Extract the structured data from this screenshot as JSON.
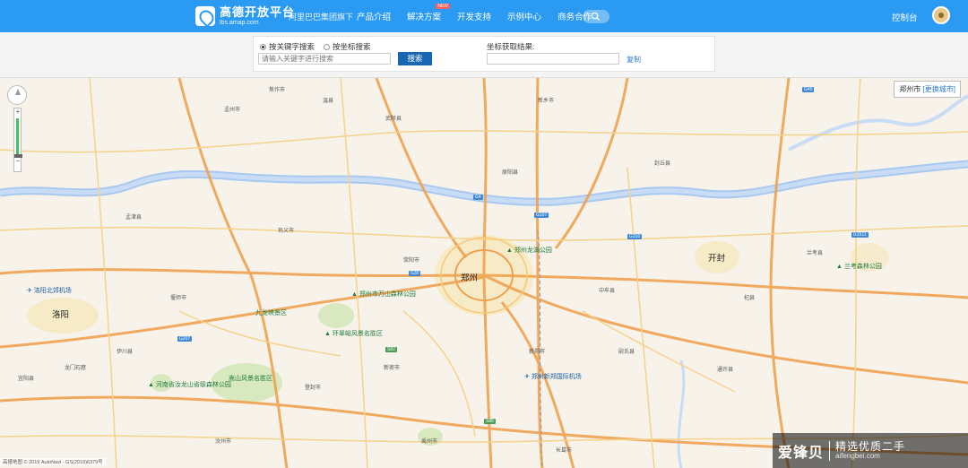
{
  "header": {
    "logo_title": "高德开放平台",
    "logo_sub": "lbs.amap.com",
    "group": "阿里巴巴集团旗下",
    "nav": [
      {
        "label": "产品介绍",
        "badge": ""
      },
      {
        "label": "解决方案",
        "badge": "NEW"
      },
      {
        "label": "开发支持",
        "badge": ""
      },
      {
        "label": "示例中心",
        "badge": ""
      },
      {
        "label": "商务合作",
        "badge": ""
      }
    ],
    "console": "控制台"
  },
  "picker": {
    "radio_keyword": "按关键字搜索",
    "radio_coord": "按坐标搜索",
    "keyword_placeholder": "请输入关键字进行搜索",
    "search_button": "搜索",
    "result_label": "坐标获取结果:",
    "result_value": "",
    "copy": "复制"
  },
  "map": {
    "current_city": "郑州市",
    "change_city": "[更换城市]",
    "copyright": "高德地图 © 2019 AutoNavi - GS(2019)6379号",
    "cities": [
      {
        "name": "郑州"
      },
      {
        "name": "开封"
      },
      {
        "name": "洛阳"
      }
    ],
    "pois": [
      {
        "name": "郑州龙湖公园"
      },
      {
        "name": "郑州市万山森林公园"
      },
      {
        "name": "环翠峪风景名胜区"
      },
      {
        "name": "九龙峡景区"
      },
      {
        "name": "河南省汝龙山省级森林公园"
      },
      {
        "name": "兰考森林公园"
      },
      {
        "name": "嵩山风景名胜区"
      }
    ],
    "airports": [
      {
        "name": "洛阳北郊机场"
      },
      {
        "name": "郑州新郑国际机场"
      }
    ],
    "places": [
      "龙门石窟",
      "荥阳市",
      "巩义市",
      "中牟县",
      "新郑市",
      "新密市",
      "登封市",
      "偃师市",
      "伊川县",
      "孟津县",
      "武陟县",
      "原阳县",
      "封丘县",
      "尉氏县",
      "通许县",
      "杞县",
      "兰考县",
      "长葛市",
      "禹州市",
      "汝州市",
      "温县",
      "孟州市",
      "焦作市",
      "新乡市",
      "宜阳县"
    ],
    "highways": [
      "G30",
      "G4",
      "G107",
      "G310",
      "G207",
      "S82",
      "G1511",
      "S88",
      "G45"
    ]
  },
  "watermark": {
    "brand": "爱锋贝",
    "slogan": "精选优质二手",
    "url": "aifengbei.com"
  }
}
